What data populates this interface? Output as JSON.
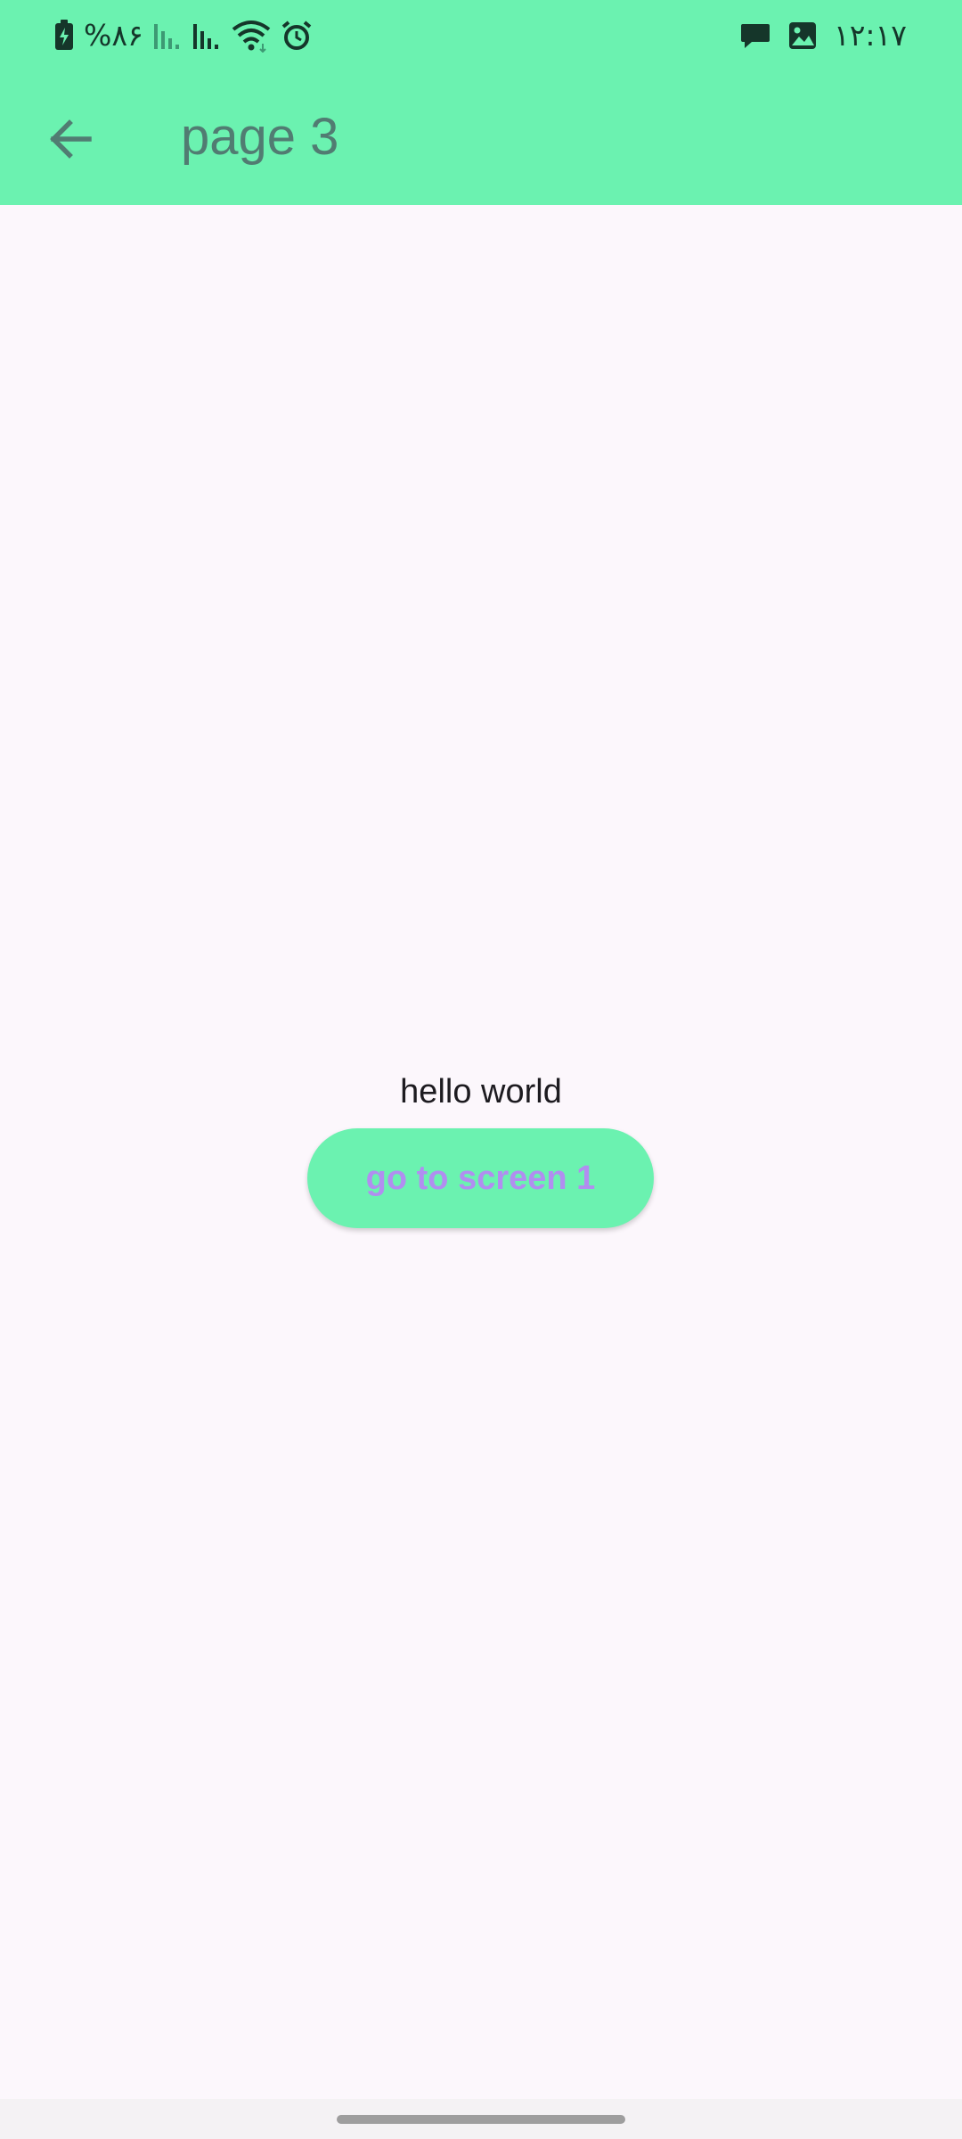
{
  "colors": {
    "appbar_bg": "#6bf2b0",
    "page_bg": "#fcf7fc",
    "title_color": "#517c72",
    "button_bg": "#6bf2b0",
    "button_text": "#b18ef0",
    "body_text": "#1d1b20"
  },
  "status_bar": {
    "battery_percent": "%۸۶",
    "time": "۱۲:۱۷",
    "left_icons": [
      "battery-charging-icon",
      "signal-bars-icon",
      "signal-bars-icon",
      "wifi-icon",
      "alarm-icon"
    ],
    "right_icons": [
      "chat-bubble-icon",
      "image-icon"
    ]
  },
  "appbar": {
    "back_icon": "arrow-back-icon",
    "title": "page 3"
  },
  "main": {
    "text": "hello world",
    "button_label": "go to screen 1"
  }
}
